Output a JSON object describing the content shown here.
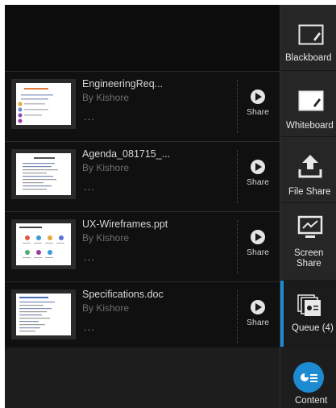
{
  "files": [
    {
      "name": "EngineeringReq...",
      "author": "By Kishore",
      "more": "...",
      "share_label": "Share"
    },
    {
      "name": "Agenda_081715_...",
      "author": "By Kishore",
      "more": "...",
      "share_label": "Share"
    },
    {
      "name": "UX-Wireframes.ppt",
      "author": "By Kishore",
      "more": "...",
      "share_label": "Share"
    },
    {
      "name": "Specifications.doc",
      "author": "By Kishore",
      "more": "...",
      "share_label": "Share"
    }
  ],
  "sidebar": {
    "blackboard": {
      "label": "Blackboard",
      "icon": "blackboard-icon"
    },
    "whiteboard": {
      "label": "Whiteboard",
      "icon": "whiteboard-icon"
    },
    "file_share": {
      "label": "File Share",
      "icon": "upload-icon"
    },
    "screen_share": {
      "label_line1": "Screen",
      "label_line2": "Share",
      "icon": "screen-share-icon"
    },
    "queue": {
      "label": "Queue (4)",
      "icon": "queue-icon"
    },
    "content": {
      "label": "Content",
      "icon": "content-icon"
    }
  },
  "colors": {
    "accent": "#1d8bd1",
    "background": "#121212",
    "sidebar": "#262626"
  }
}
